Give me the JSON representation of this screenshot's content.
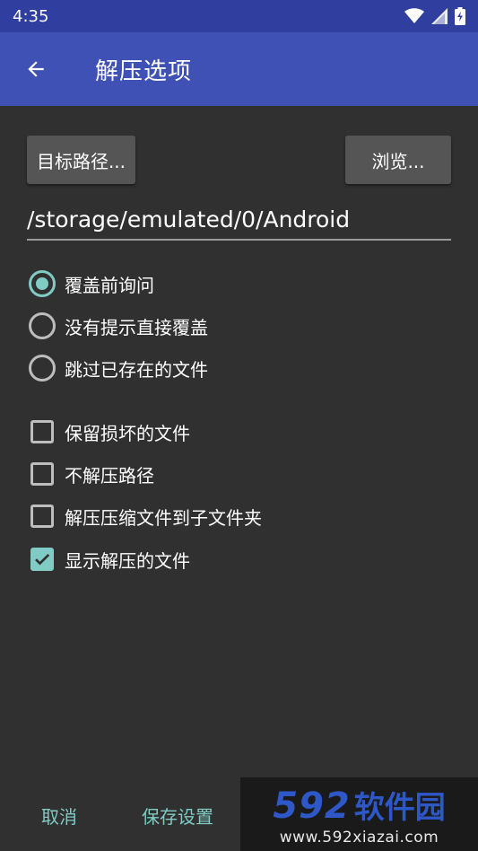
{
  "status_bar": {
    "time": "4:35",
    "icons": [
      "wifi-icon",
      "signal-icon",
      "battery-charging-icon"
    ]
  },
  "app_bar": {
    "title": "解压选项",
    "back_icon": "arrow-left-icon"
  },
  "path": {
    "target_button": "目标路径...",
    "browse_button": "浏览...",
    "value": "/storage/emulated/0/Android"
  },
  "overwrite_options": [
    {
      "label": "覆盖前询问",
      "selected": true
    },
    {
      "label": "没有提示直接覆盖",
      "selected": false
    },
    {
      "label": "跳过已存在的文件",
      "selected": false
    }
  ],
  "checkboxes": [
    {
      "label": "保留损坏的文件",
      "checked": false
    },
    {
      "label": "不解压路径",
      "checked": false
    },
    {
      "label": "解压压缩文件到子文件夹",
      "checked": false
    },
    {
      "label": "显示解压的文件",
      "checked": true
    }
  ],
  "footer": {
    "cancel": "取消",
    "save_settings": "保存设置"
  },
  "watermark": {
    "number": "592",
    "name": "软件园",
    "url": "www.592xiazai.com"
  },
  "colors": {
    "status_bar": "#303f9f",
    "app_bar": "#3f51b5",
    "background": "#303030",
    "accent": "#80cbc4",
    "button": "#555555"
  }
}
